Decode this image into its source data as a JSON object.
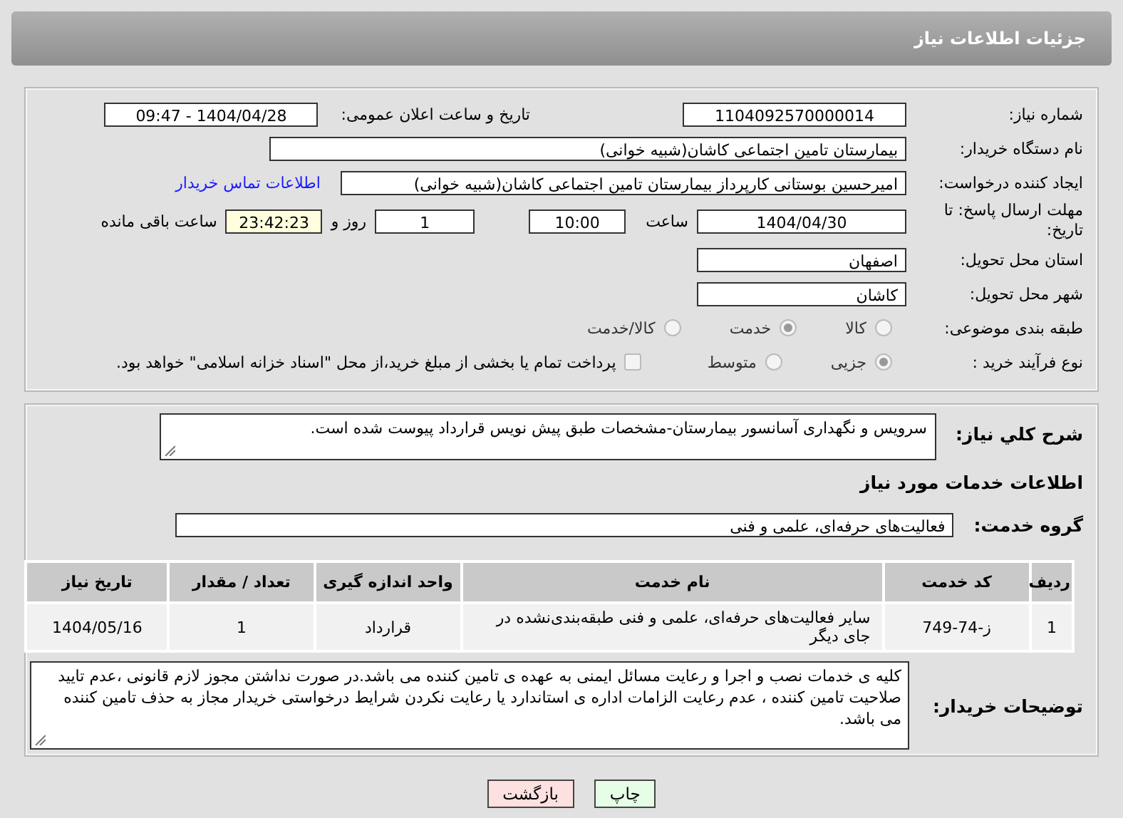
{
  "header": {
    "title": "جزئیات اطلاعات نیاز"
  },
  "details": {
    "need_number": {
      "label": "شماره نیاز:",
      "value": "1104092570000014"
    },
    "announce": {
      "label": "تاریخ و ساعت اعلان عمومی:",
      "value": "1404/04/28 - 09:47"
    },
    "buyer_org": {
      "label": "نام دستگاه خریدار:",
      "value": "بیمارستان تامین اجتماعی کاشان(شبیه خوانی)"
    },
    "requester": {
      "label": "ایجاد کننده درخواست:",
      "value": "امیرحسین بوستانی کارپرداز بیمارستان تامین اجتماعی کاشان(شبیه خوانی)",
      "link": "اطلاعات تماس خریدار"
    },
    "deadline": {
      "label": "مهلت ارسال پاسخ: تا تاریخ:",
      "date": "1404/04/30",
      "time_label": "ساعت",
      "time": "10:00",
      "days": "1",
      "days_label": "روز و",
      "remaining": "23:42:23",
      "remaining_label": "ساعت باقی مانده"
    },
    "province": {
      "label": "استان محل تحویل:",
      "value": "اصفهان"
    },
    "city": {
      "label": "شهر محل تحویل:",
      "value": "کاشان"
    },
    "category": {
      "label": "طبقه بندی موضوعی:",
      "options": [
        {
          "label": "کالا",
          "selected": false
        },
        {
          "label": "خدمت",
          "selected": true
        },
        {
          "label": "کالا/خدمت",
          "selected": false
        }
      ]
    },
    "process": {
      "label": "نوع فرآیند خرید :",
      "options": [
        {
          "label": "جزیی",
          "selected": true
        },
        {
          "label": "متوسط",
          "selected": false
        }
      ],
      "payment": {
        "label": "پرداخت تمام یا بخشی از مبلغ خرید،از محل \"اسناد خزانه اسلامی\" خواهد بود.",
        "checked": false
      }
    }
  },
  "needs": {
    "summary": {
      "label": "شرح کلي نياز:",
      "value": "سرویس و نگهداری آسانسور بیمارستان-مشخصات طبق پیش نویس قرارداد پیوست شده است."
    },
    "services_heading": "اطلاعات خدمات مورد نیاز",
    "group": {
      "label": "گروه خدمت:",
      "value": "فعالیت‌های حرفه‌ای، علمی و فنی"
    },
    "table": {
      "columns": [
        "ردیف",
        "کد خدمت",
        "نام خدمت",
        "واحد اندازه گیری",
        "تعداد / مقدار",
        "تاریخ نیاز"
      ],
      "rows": [
        [
          "1",
          "ز-74-749",
          "سایر فعالیت‌های حرفه‌ای، علمی و فنی طبقه‌بندی‌نشده در جای دیگر",
          "قرارداد",
          "1",
          "1404/05/16"
        ]
      ]
    },
    "notes": {
      "label": "توضیحات خریدار:",
      "value": "کلیه ی خدمات نصب و اجرا و رعایت مسائل ایمنی به عهده ی تامین کننده می باشد.در صورت نداشتن مجوز لازم قانونی ،عدم تایید صلاحیت تامین کننده ، عدم رعایت الزامات اداره ی استاندارد یا رعایت نکردن شرایط درخواستی خریدار مجاز به حذف تامین کننده می باشد."
    }
  },
  "buttons": [
    {
      "label": "چاپ",
      "kind": "print"
    },
    {
      "label": "بازگشت",
      "kind": "back"
    }
  ]
}
